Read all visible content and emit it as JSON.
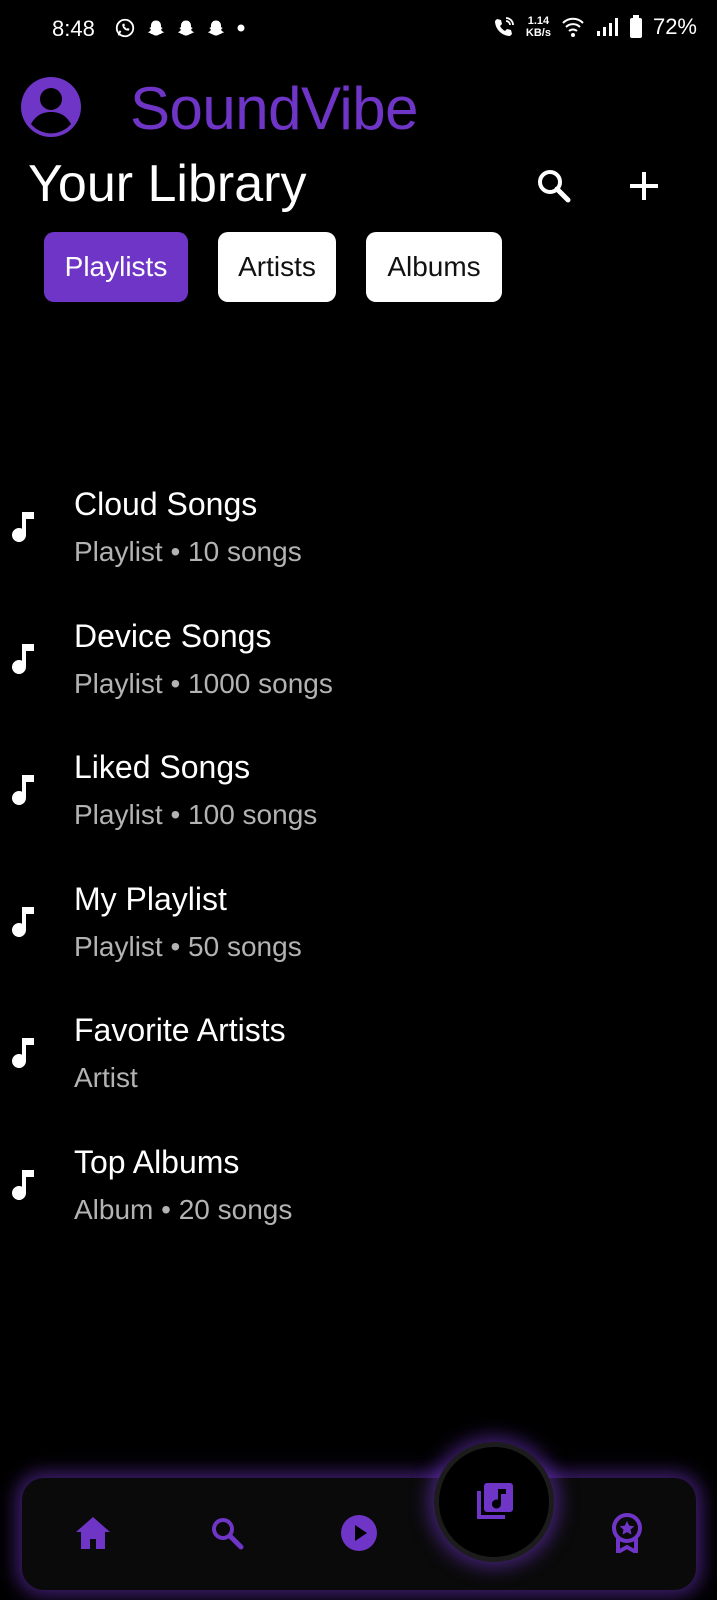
{
  "status_bar": {
    "time": "8:48",
    "speed_value": "1.14",
    "speed_unit": "KB/s",
    "battery": "72%"
  },
  "app": {
    "name": "SoundVibe",
    "accent_color": "#6f35c6"
  },
  "header": {
    "title": "Your Library",
    "icons": [
      "search-icon",
      "add-icon"
    ]
  },
  "tabs": [
    {
      "label": "Playlists",
      "active": true
    },
    {
      "label": "Artists",
      "active": false
    },
    {
      "label": "Albums",
      "active": false
    }
  ],
  "library": {
    "items": [
      {
        "title": "Cloud Songs",
        "subtitle": "Playlist • 10 songs"
      },
      {
        "title": "Device Songs",
        "subtitle": "Playlist • 1000 songs"
      },
      {
        "title": "Liked Songs",
        "subtitle": "Playlist • 100 songs"
      },
      {
        "title": "My Playlist",
        "subtitle": "Playlist • 50 songs"
      },
      {
        "title": "Favorite Artists",
        "subtitle": "Artist"
      },
      {
        "title": "Top Albums",
        "subtitle": "Album • 20 songs"
      }
    ]
  },
  "bottom_nav": {
    "items": [
      "home-icon",
      "search-icon",
      "play-icon",
      "library-music-icon",
      "award-icon"
    ],
    "selected": "library-music-icon"
  }
}
